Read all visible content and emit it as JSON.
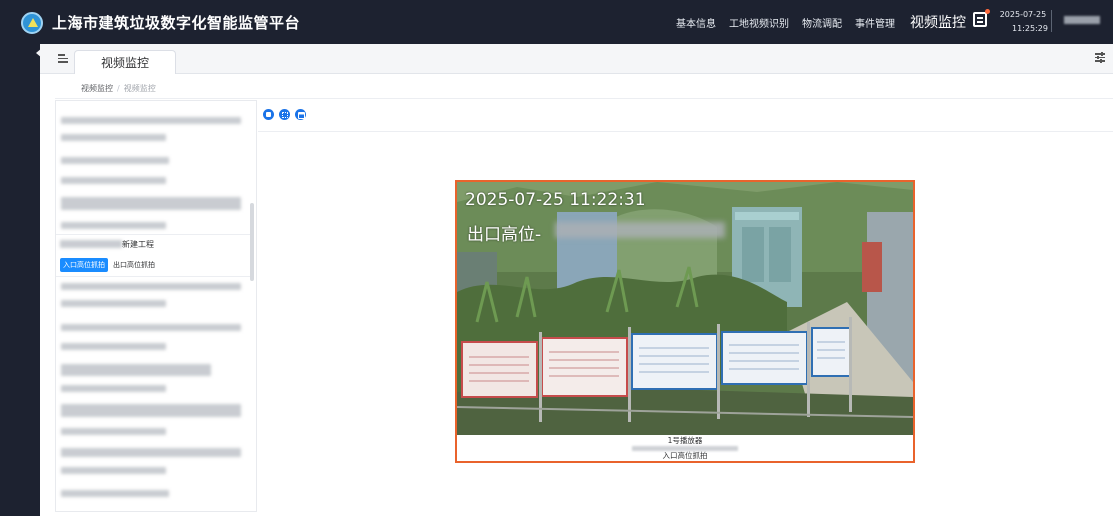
{
  "header": {
    "app_title": "上海市建筑垃圾数字化智能监管平台",
    "nav": [
      "基本信息",
      "工地视频识别",
      "物流调配",
      "事件管理"
    ],
    "active_nav": "视频监控",
    "date": "2025-07-25",
    "time": "11:25:29"
  },
  "tabs": [
    {
      "label": "视频监控"
    }
  ],
  "breadcrumb": {
    "root": "视频监控",
    "sep": "/",
    "current": "视频监控"
  },
  "tree": {
    "project_suffix": "新建工程",
    "cameras": [
      "入口高位抓拍",
      "出口高位抓拍"
    ],
    "selected_camera": "入口高位抓拍"
  },
  "layout_buttons": [
    "single",
    "four",
    "nine"
  ],
  "player": {
    "osd_time": "2025-07-25 11:22:31",
    "osd_location": "出口高位-",
    "name": "1号播放器",
    "stream": "入口高位抓拍"
  },
  "colors": {
    "topbar": "#1d2230",
    "accent": "#1a8cff",
    "player_border": "#e9632c"
  },
  "icons": {
    "logo": "globe-logo",
    "menu_toggle": "menu-fold-icon",
    "message": "message-icon",
    "settings": "settings-sliders-icon"
  }
}
